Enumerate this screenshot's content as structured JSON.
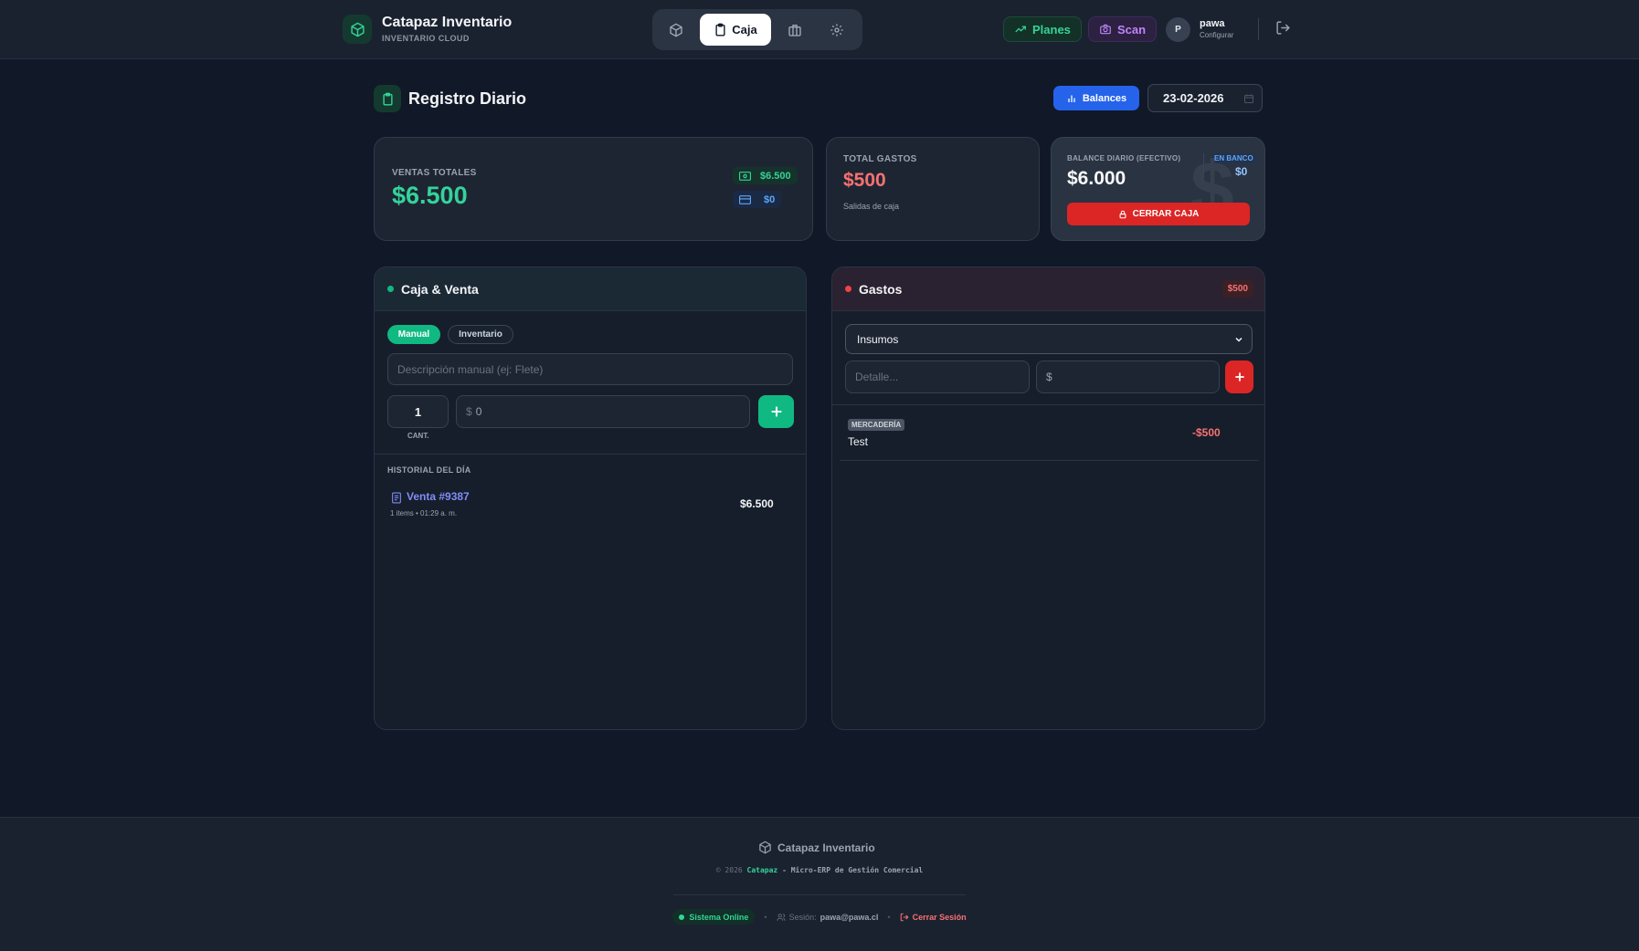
{
  "header": {
    "brand_title": "Catapaz Inventario",
    "brand_subtitle": "INVENTARIO CLOUD",
    "nav_active_label": "Caja",
    "planes_label": "Planes",
    "scan_label": "Scan",
    "avatar_initial": "P",
    "user_name": "pawa",
    "user_action": "Configurar"
  },
  "page": {
    "title": "Registro Diario",
    "balances_label": "Balances",
    "date": "23-02-2026"
  },
  "stats": {
    "ventas": {
      "label": "VENTAS TOTALES",
      "value": "$6.500",
      "cash": "$6.500",
      "card": "$0"
    },
    "gastos": {
      "label": "TOTAL GASTOS",
      "value": "$500",
      "sub": "Salidas de caja"
    },
    "balance": {
      "label": "BALANCE DIARIO (EFECTIVO)",
      "value": "$6.000",
      "bank_label": "EN BANCO",
      "bank_value": "$0",
      "close_label": "CERRAR CAJA",
      "watermark": "$"
    }
  },
  "caja": {
    "title": "Caja & Venta",
    "tab_manual": "Manual",
    "tab_inventario": "Inventario",
    "desc_placeholder": "Descripción manual (ej: Flete)",
    "qty_value": "1",
    "qty_label": "CANT.",
    "price_prefix": "$",
    "price_placeholder": "0",
    "history_label": "HISTORIAL DEL DÍA",
    "sales": [
      {
        "title": "Venta #9387",
        "meta": "1 items • 01:29 a. m.",
        "amount": "$6.500"
      }
    ]
  },
  "gastos": {
    "title": "Gastos",
    "badge": "$500",
    "category_selected": "Insumos",
    "detail_placeholder": "Detalle...",
    "amount_prefix": "$",
    "items": [
      {
        "category": "MERCADERÍA",
        "name": "Test",
        "amount": "-$500"
      }
    ]
  },
  "footer": {
    "brand": "Catapaz Inventario",
    "copy_prefix": "© 2026",
    "copy_brand": "Catapaz",
    "copy_suffix": "- Micro-ERP de Gestión Comercial",
    "status": "Sistema Online",
    "session_label": "Sesión:",
    "session_email": "pawa@pawa.cl",
    "logout": "Cerrar Sesión",
    "bullet": "•"
  },
  "colors": {
    "accent_green": "#10b981",
    "accent_red": "#dc2626",
    "accent_blue": "#2563eb",
    "background": "#111827"
  }
}
